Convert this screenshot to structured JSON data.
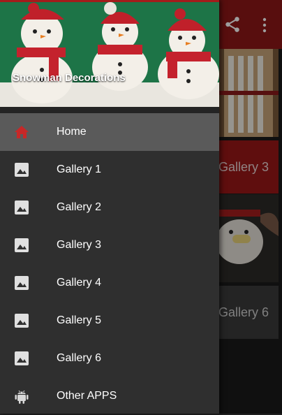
{
  "drawer": {
    "header_title": "Snowman Decorations",
    "items": [
      {
        "label": "Home",
        "icon": "home-icon",
        "active": true
      },
      {
        "label": "Gallery 1",
        "icon": "image-icon"
      },
      {
        "label": "Gallery 2",
        "icon": "image-icon"
      },
      {
        "label": "Gallery 3",
        "icon": "image-icon"
      },
      {
        "label": "Gallery 4",
        "icon": "image-icon"
      },
      {
        "label": "Gallery 5",
        "icon": "image-icon"
      },
      {
        "label": "Gallery 6",
        "icon": "image-icon"
      },
      {
        "label": "Other APPS",
        "icon": "android-icon"
      }
    ]
  },
  "app": {
    "toolbar": {
      "share_icon": "share-icon",
      "more_icon": "more-vert-icon"
    },
    "cards": [
      {
        "label": "Gallery 3"
      },
      {
        "label": "Gallery 6"
      }
    ]
  },
  "colors": {
    "appbar": "#8e1717",
    "drawer_bg": "#2f2f2f",
    "active_item": "#5a5a5a",
    "home_icon": "#c62828"
  }
}
